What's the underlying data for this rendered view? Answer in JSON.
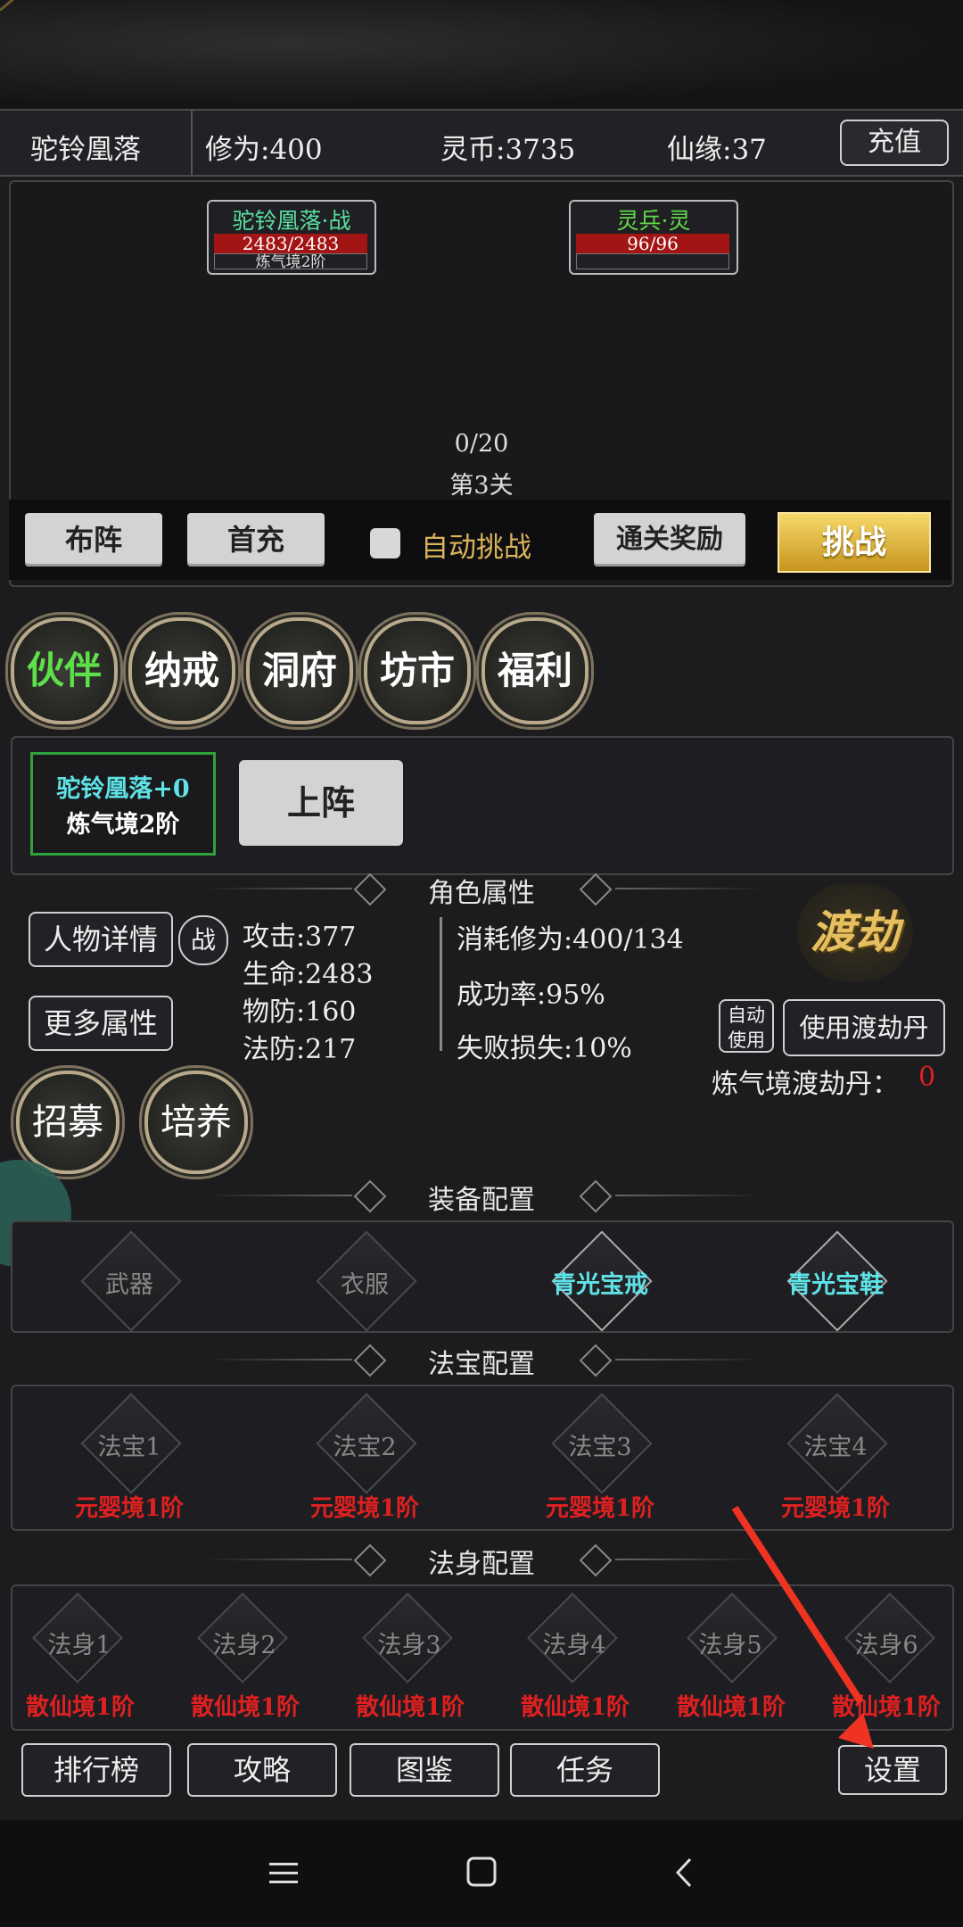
{
  "status": {
    "name": "驼铃凰落",
    "cultivation": "修为:400",
    "spirit_coins": "灵币:3735",
    "xianyuan": "仙缘:37",
    "recharge": "充值"
  },
  "battle": {
    "ally": {
      "name": "驼铃凰落·战",
      "hp": "2483/2483",
      "realm": "炼气境2阶"
    },
    "enemy": {
      "name": "灵兵·灵",
      "hp": "96/96"
    },
    "progress": "0/20",
    "stage": "第3关",
    "buttons": {
      "formation": "布阵",
      "first_charge": "首充",
      "auto": "自动挑战",
      "clear_reward": "通关奖励",
      "challenge": "挑战"
    }
  },
  "menu": [
    "伙伴",
    "纳戒",
    "洞府",
    "坊市",
    "福利"
  ],
  "companion": {
    "card_line1": "驼铃凰落+0",
    "card_line2": "炼气境2阶",
    "deploy": "上阵"
  },
  "attributes": {
    "title": "角色属性",
    "detail_btn": "人物详情",
    "battle_tag": "战",
    "more_btn": "更多属性",
    "atk": "攻击:377",
    "hp": "生命:2483",
    "pdef": "物防:160",
    "mdef": "法防:217",
    "cost": "消耗修为:400/134",
    "success": "成功率:95%",
    "loss": "失败损失:10%",
    "dujie": "渡劫",
    "auto_use": "自动使用",
    "use_pill": "使用渡劫丹",
    "pill_label": "炼气境渡劫丹：",
    "pill_count": "0",
    "recruit": "招募",
    "train": "培养"
  },
  "equipment": {
    "title": "装备配置",
    "slots": [
      "武器",
      "衣服",
      "青光宝戒",
      "青光宝鞋"
    ]
  },
  "treasures": {
    "title": "法宝配置",
    "slots": [
      "法宝1",
      "法宝2",
      "法宝3",
      "法宝4"
    ],
    "req": "元婴境1阶"
  },
  "bodies": {
    "title": "法身配置",
    "slots": [
      "法身1",
      "法身2",
      "法身3",
      "法身4",
      "法身5",
      "法身6"
    ],
    "req": "散仙境1阶"
  },
  "bottom": {
    "rank": "排行榜",
    "guide": "攻略",
    "codex": "图鉴",
    "task": "任务",
    "settings": "设置"
  }
}
